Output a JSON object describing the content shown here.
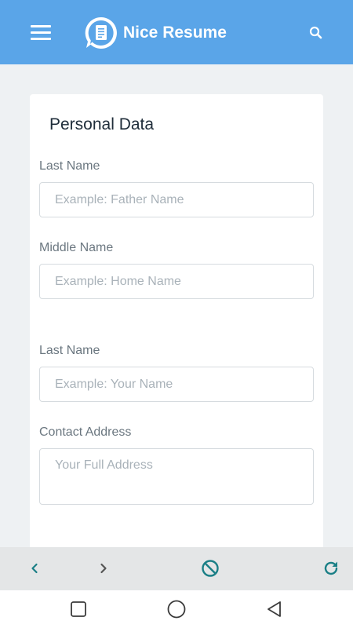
{
  "app": {
    "title": "Nice Resume"
  },
  "form": {
    "section_title": "Personal Data",
    "fields": [
      {
        "label": "Last Name",
        "placeholder": "Example: Father Name",
        "value": ""
      },
      {
        "label": "Middle Name",
        "placeholder": "Example: Home Name",
        "value": ""
      },
      {
        "label": "Last Name",
        "placeholder": "Example: Your Name",
        "value": ""
      },
      {
        "label": "Contact Address",
        "placeholder": "Your Full Address",
        "value": ""
      }
    ]
  },
  "browser_toolbar": {
    "icons": [
      "chevron-left-icon",
      "chevron-right-icon",
      "stop-icon",
      "reload-icon"
    ]
  },
  "system_nav": {
    "icons": [
      "recents-icon",
      "home-icon",
      "back-icon"
    ]
  },
  "colors": {
    "app_bar": "#5aa5e8",
    "accent_teal": "#1a7f86",
    "page_background": "#eef1f3",
    "card_background": "#ffffff"
  }
}
